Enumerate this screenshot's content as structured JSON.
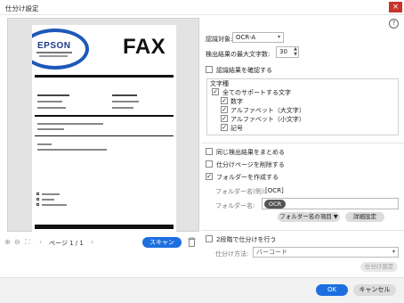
{
  "window": {
    "title": "仕分け設定",
    "close_glyph": "×",
    "help_glyph": "?"
  },
  "preview": {
    "logo_text": "EPSON",
    "doc_title": "FAX",
    "page_label": "ページ 1 / 1",
    "scan_label": "スキャン"
  },
  "form": {
    "recognition_target_label": "認識対象:",
    "recognition_target_value": "OCR-A",
    "max_chars_label": "検出結果の最大文字数:",
    "max_chars_value": "30",
    "confirm_results_label": "認識結果を確認する",
    "char_type_group_label": "文字種",
    "all_chars_label": "全てのサポートする文字",
    "char_types": [
      {
        "label": "数字",
        "checked": true
      },
      {
        "label": "アルファベット（大文字）",
        "checked": true
      },
      {
        "label": "アルファベット（小文字）",
        "checked": true
      },
      {
        "label": "記号",
        "checked": true
      }
    ],
    "combine_same_label": "同じ検出結果をまとめる",
    "delete_sort_page_label": "仕分けページを削除する",
    "create_folder_label": "フォルダーを作成する",
    "folder_example_label": "フォルダー名(例):",
    "folder_example_value": "[OCR]",
    "folder_name_label": "フォルダー名:",
    "folder_name_token": "OCR",
    "folder_items_button": "フォルダー名の項目 ▼",
    "detail_settings_button": "詳細設定",
    "two_stage_label": "2段階で仕分けを行う",
    "sort_method_label": "仕分け方法:",
    "sort_method_value": "バーコード",
    "sort_settings_button": "仕分け設定"
  },
  "footer": {
    "ok_label": "OK",
    "cancel_label": "キャンセル"
  },
  "colors": {
    "accent": "#1d6fe0",
    "close": "#c6342c",
    "logo_ring": "#1d58b8"
  }
}
